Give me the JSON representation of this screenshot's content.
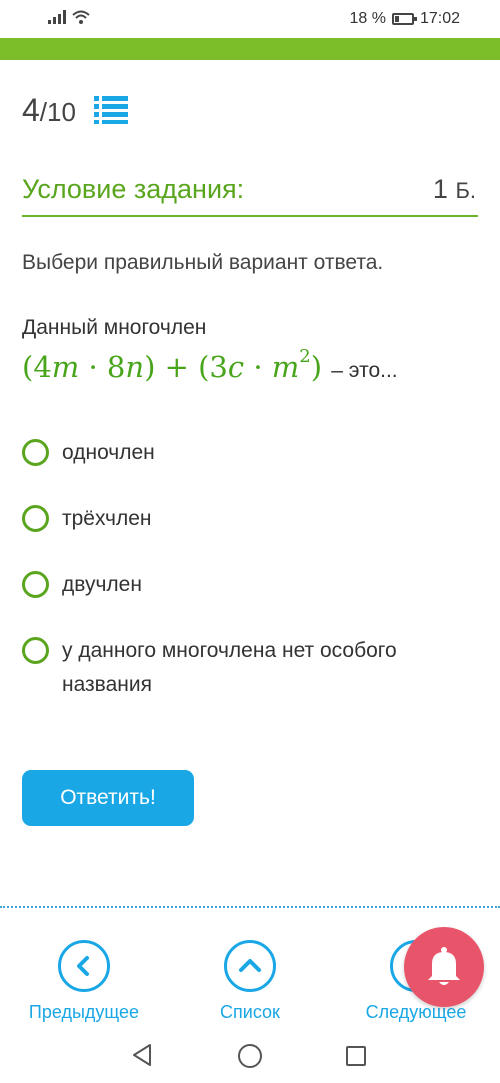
{
  "status_bar": {
    "battery_text": "18 %",
    "battery_level": 0.18,
    "time": "17:02",
    "icons": [
      "signal-icon",
      "wifi-icon",
      "battery-icon"
    ]
  },
  "progress": {
    "current": "4",
    "total": "/10"
  },
  "task": {
    "title": "Условие задания:",
    "points_value": "1",
    "points_unit": "Б.",
    "instruction": "Выбери правильный вариант ответа.",
    "question_head": "Данный многочлен",
    "question_tail": "– это...",
    "formula_parts": {
      "open1": "(4",
      "var_m": "m",
      "dot": " · 8",
      "var_n": "n",
      "close1": ") + (3",
      "var_c": "c",
      "dot2": " · ",
      "var_m2": "m",
      "exp": "2",
      "close2": ")"
    }
  },
  "options": [
    {
      "label": "одночлен"
    },
    {
      "label": "трёхчлен"
    },
    {
      "label": "двучлен"
    },
    {
      "label": "у данного многочлена нет особого названия"
    }
  ],
  "answer_button": {
    "label": "Ответить!"
  },
  "bottom_nav": {
    "prev_label": "Предыдущее",
    "list_label": "Список",
    "next_label": "Следующее"
  },
  "colors": {
    "green": "#7cbd2a",
    "blue": "#1aa7e6",
    "bell": "#e8556a"
  }
}
